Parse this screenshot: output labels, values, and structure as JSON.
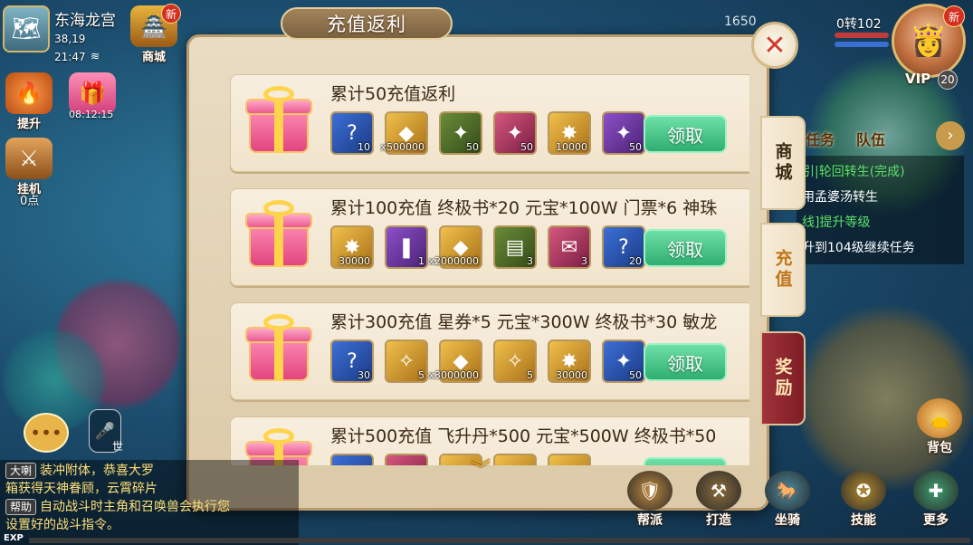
{
  "hud": {
    "map_name": "东海龙宫",
    "coords": "38,19",
    "time": "21:47",
    "shop_label": "商城",
    "shop_badge": "新",
    "upgrade_label": "提升",
    "event_timer": "08:12:15",
    "hangup_label": "挂机",
    "hangup_points": "0点",
    "zhuan": "0转102",
    "vip_label": "VIP",
    "vip_level": "20",
    "avatar_badge": "新",
    "top_num": "1650"
  },
  "task_panel": {
    "tabs": [
      "任务",
      "队伍"
    ],
    "lines": [
      {
        "text": "引|轮回转生(完成)",
        "color": "green"
      },
      {
        "text": "用孟婆汤转生",
        "color": "white"
      },
      {
        "text": "线]提升等级",
        "color": "green"
      },
      {
        "text": "升到104级继续任务",
        "color": "white"
      }
    ]
  },
  "side_tabs": {
    "shop": "商城",
    "recharge": "充值",
    "reward": "奖励"
  },
  "dialog": {
    "title": "充值返利",
    "claim_label": "领取",
    "rows": [
      {
        "title": "累计50充值返利",
        "items": [
          {
            "icon": "skill-book-icon",
            "glyph": "?",
            "quality": "blue",
            "count": "10"
          },
          {
            "icon": "gold-ingot-icon",
            "glyph": "◆",
            "quality": "gold",
            "count": "x500000"
          },
          {
            "icon": "green-dragon-icon",
            "glyph": "✦",
            "quality": "green",
            "count": "50"
          },
          {
            "icon": "red-dragon-icon",
            "glyph": "✦",
            "quality": "red",
            "count": "50"
          },
          {
            "icon": "gold-coin-icon",
            "glyph": "✸",
            "quality": "gold",
            "count": "10000"
          },
          {
            "icon": "blue-dragon-icon",
            "glyph": "✦",
            "quality": "purple",
            "count": "50"
          }
        ]
      },
      {
        "title": "累计100充值 终极书*20 元宝*100W 门票*6 神珠",
        "items": [
          {
            "icon": "gold-coin-icon",
            "glyph": "✸",
            "quality": "gold",
            "count": "30000"
          },
          {
            "icon": "scroll-tube-icon",
            "glyph": "❚",
            "quality": "purple",
            "count": "1"
          },
          {
            "icon": "gold-ingot-icon",
            "glyph": "◆",
            "quality": "gold",
            "count": "x2000000"
          },
          {
            "icon": "treasure-map-icon",
            "glyph": "▤",
            "quality": "green",
            "count": "3"
          },
          {
            "icon": "ticket-icon",
            "glyph": "✉",
            "quality": "red",
            "count": "3"
          },
          {
            "icon": "skill-book-icon",
            "glyph": "?",
            "quality": "blue",
            "count": "20"
          }
        ]
      },
      {
        "title": "累计300充值 星券*5 元宝*300W 终极书*30 敏龙",
        "items": [
          {
            "icon": "skill-book-icon",
            "glyph": "?",
            "quality": "blue",
            "count": "30"
          },
          {
            "icon": "star-scroll-icon",
            "glyph": "✧",
            "quality": "gold",
            "count": "5"
          },
          {
            "icon": "gold-ingot-icon",
            "glyph": "◆",
            "quality": "gold",
            "count": "x3000000"
          },
          {
            "icon": "star-scroll-icon",
            "glyph": "✧",
            "quality": "gold",
            "count": "5"
          },
          {
            "icon": "gold-coin-icon",
            "glyph": "✸",
            "quality": "gold",
            "count": "30000"
          },
          {
            "icon": "cyan-dragon-icon",
            "glyph": "✦",
            "quality": "blue",
            "count": "50"
          }
        ]
      },
      {
        "title": "累计500充值 飞升丹*500 元宝*500W 终极书*50",
        "items": [
          {
            "icon": "skill-book-icon",
            "glyph": "?",
            "quality": "blue",
            "count": ""
          },
          {
            "icon": "red-pill-icon",
            "glyph": "●",
            "quality": "red",
            "count": ""
          },
          {
            "icon": "gold-ingot-icon",
            "glyph": "◆",
            "quality": "gold",
            "count": ""
          },
          {
            "icon": "star-scroll-icon",
            "glyph": "✧",
            "quality": "gold",
            "count": ""
          },
          {
            "icon": "gold-coin-icon",
            "glyph": "✸",
            "quality": "gold",
            "count": ""
          }
        ]
      }
    ]
  },
  "chat": {
    "voice_label": "世",
    "lines": [
      {
        "tag": "大喇",
        "text": "装冲附体，恭喜大罗",
        "color": "yellow"
      },
      {
        "tag": "",
        "text": "箱获得天神眷顾，云霄碎片",
        "color": "yellow"
      },
      {
        "tag": "帮助",
        "text": "自动战斗时主角和召唤兽会执行您",
        "color": "yellow"
      },
      {
        "tag": "",
        "text": "设置好的战斗指令。",
        "color": "yellow"
      }
    ],
    "exp_label": "EXP"
  },
  "bottom_buttons": [
    {
      "name": "guild-button",
      "label": "帮派"
    },
    {
      "name": "forge-button",
      "label": "打造"
    },
    {
      "name": "mount-button",
      "label": "坐骑"
    },
    {
      "name": "skill-button",
      "label": "技能"
    },
    {
      "name": "more-button",
      "label": "更多"
    }
  ],
  "backpack_label": "背包"
}
